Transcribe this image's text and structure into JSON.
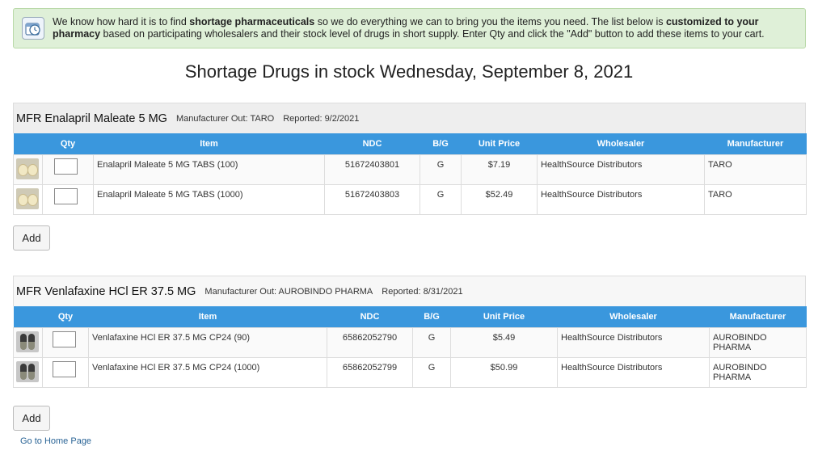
{
  "notice": {
    "icon": "clock-calendar-icon",
    "text_1": "We know how hard it is to find ",
    "bold_1": "shortage pharmaceuticals",
    "text_2": " so we do everything we can to bring you the items you need. The list below is ",
    "bold_2": "customized to your pharmacy",
    "text_3": " based on participating wholesalers and their stock level of drugs in short supply. Enter Qty and click the \"Add\" button to add these items to your cart."
  },
  "page_title": "Shortage Drugs in stock Wednesday, September 8, 2021",
  "columns": [
    "",
    "Qty",
    "Item",
    "NDC",
    "B/G",
    "Unit Price",
    "Wholesaler",
    "Manufacturer"
  ],
  "sections": [
    {
      "drug": "MFR Enalapril Maleate 5 MG",
      "manufacturer_out": "Manufacturer Out: TARO",
      "reported": "Reported: 9/2/2021",
      "rows": [
        {
          "image": "tablet-image",
          "qty": "",
          "item": "Enalapril Maleate 5 MG TABS (100)",
          "ndc": "51672403801",
          "bg": "G",
          "price": "$7.19",
          "wholesaler": "HealthSource Distributors",
          "manufacturer": "TARO"
        },
        {
          "image": "tablet-image",
          "qty": "",
          "item": "Enalapril Maleate 5 MG TABS (1000)",
          "ndc": "51672403803",
          "bg": "G",
          "price": "$52.49",
          "wholesaler": "HealthSource Distributors",
          "manufacturer": "TARO"
        }
      ],
      "add_label": "Add"
    },
    {
      "drug": "MFR Venlafaxine HCl ER 37.5 MG",
      "manufacturer_out": "Manufacturer Out: AUROBINDO PHARMA",
      "reported": "Reported: 8/31/2021",
      "rows": [
        {
          "image": "capsule-image",
          "qty": "",
          "item": "Venlafaxine HCl ER 37.5 MG CP24 (90)",
          "ndc": "65862052790",
          "bg": "G",
          "price": "$5.49",
          "wholesaler": "HealthSource Distributors",
          "manufacturer": "AUROBINDO PHARMA"
        },
        {
          "image": "capsule-image",
          "qty": "",
          "item": "Venlafaxine HCl ER 37.5 MG CP24 (1000)",
          "ndc": "65862052799",
          "bg": "G",
          "price": "$50.99",
          "wholesaler": "HealthSource Distributors",
          "manufacturer": "AUROBINDO PHARMA"
        }
      ],
      "add_label": "Add"
    }
  ],
  "home_link": "Go to Home Page",
  "colors": {
    "header_blue": "#3a97dd",
    "notice_green": "#dff0d8",
    "link": "#2a6496"
  }
}
